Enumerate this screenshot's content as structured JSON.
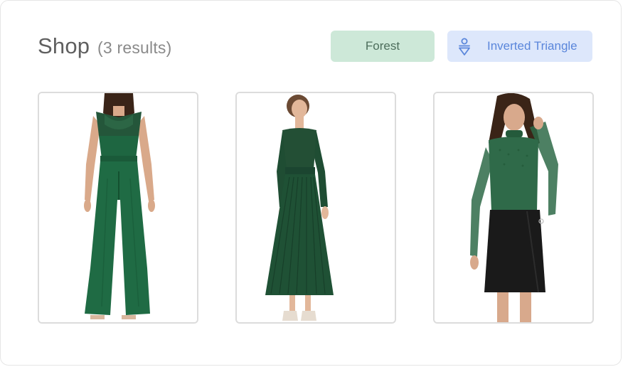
{
  "header": {
    "title": "Shop",
    "count": "(3 results)"
  },
  "filters": [
    {
      "label": "Forest",
      "color": "#cde8d8"
    },
    {
      "label": "Inverted Triangle",
      "icon": "inverted-triangle-body-icon",
      "color": "#dde7fb"
    }
  ],
  "products": [
    {
      "image": "green-lace-jumpsuit-photo"
    },
    {
      "image": "green-pleated-knit-dress-photo"
    },
    {
      "image": "green-mesh-top-black-skirt-photo"
    }
  ],
  "colors": {
    "forest": "#1f5a3a",
    "accent_blue": "#5a86db"
  }
}
